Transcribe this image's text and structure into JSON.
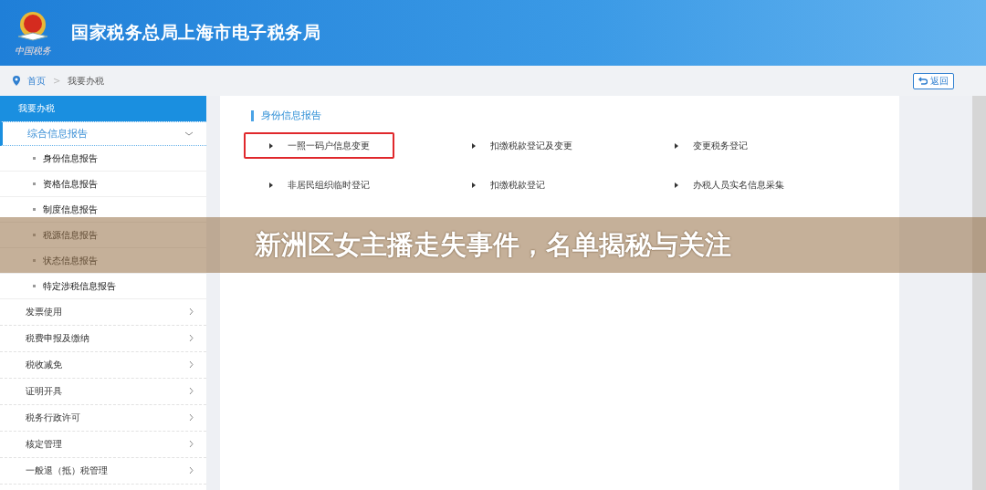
{
  "header": {
    "title": "国家税务总局上海市电子税务局",
    "emblem_caption": "中国税务"
  },
  "breadcrumb": {
    "items": [
      "首页",
      "我要办税"
    ],
    "separator": ">",
    "back_button": "返回"
  },
  "sidebar": {
    "title": "我要办税",
    "groups": [
      {
        "label": "综合信息报告",
        "expanded": true,
        "children": [
          {
            "label": "身份信息报告"
          },
          {
            "label": "资格信息报告"
          },
          {
            "label": "制度信息报告"
          },
          {
            "label": "税源信息报告"
          },
          {
            "label": "状态信息报告"
          },
          {
            "label": "特定涉税信息报告"
          }
        ]
      },
      {
        "label": "发票使用",
        "expanded": false
      },
      {
        "label": "税费申报及缴纳",
        "expanded": false
      },
      {
        "label": "税收减免",
        "expanded": false
      },
      {
        "label": "证明开具",
        "expanded": false
      },
      {
        "label": "税务行政许可",
        "expanded": false
      },
      {
        "label": "核定管理",
        "expanded": false
      },
      {
        "label": "一般退（抵）税管理",
        "expanded": false
      }
    ]
  },
  "content": {
    "section_title": "身份信息报告",
    "links": [
      {
        "label": "一照一码户信息变更",
        "highlighted": true
      },
      {
        "label": "扣缴税款登记及变更",
        "highlighted": false
      },
      {
        "label": "变更税务登记",
        "highlighted": false
      },
      {
        "label": "非居民组织临时登记",
        "highlighted": false
      },
      {
        "label": "扣缴税款登记",
        "highlighted": false
      },
      {
        "label": "办税人员实名信息采集",
        "highlighted": false
      }
    ]
  },
  "banner": {
    "headline": "新洲区女主播走失事件，名单揭秘与关注"
  }
}
